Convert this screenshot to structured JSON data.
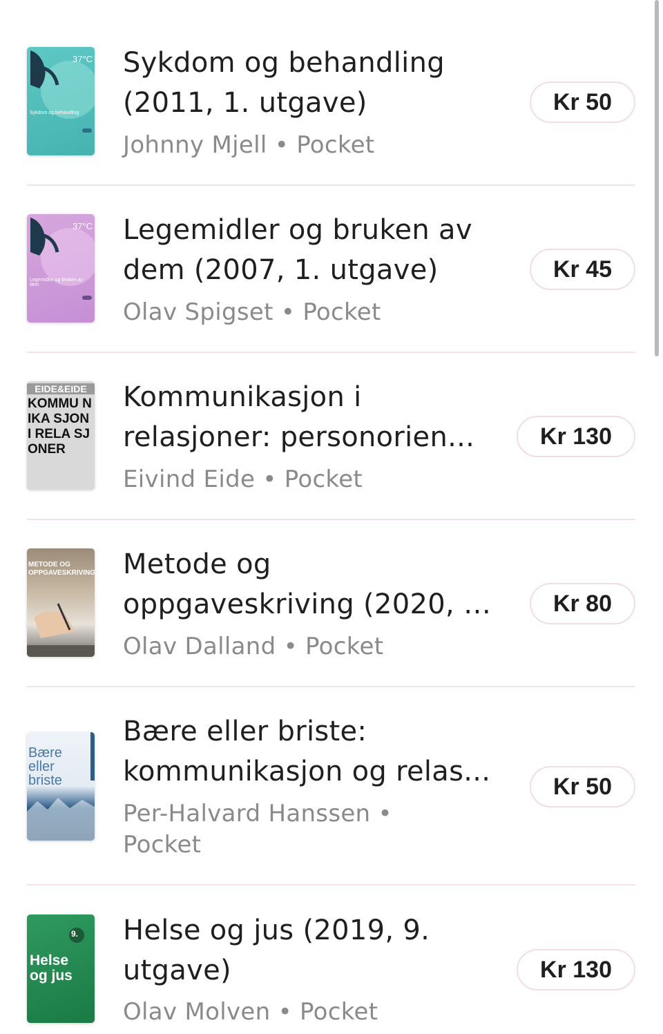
{
  "books": [
    {
      "title_line1": "Sykdom og behandling",
      "title_line2": "(2011, 1. utgave)",
      "author": "Johnny Mjell",
      "format": "Pocket",
      "price": "Kr 50",
      "cover_text": "Sykdom og behandling",
      "cover_badge": "37°C"
    },
    {
      "title_line1": "Legemidler og bruken av",
      "title_line2": "dem (2007, 1. utgave)",
      "author": "Olav Spigset",
      "format": "Pocket",
      "price": "Kr 45",
      "cover_text": "Legemidler og bruken av dem",
      "cover_badge": "37°C"
    },
    {
      "title_line1": "Kommunikasjon i",
      "title_line2": "relasjoner: personorien...",
      "author": "Eivind Eide",
      "format": "Pocket",
      "price": "Kr 130",
      "cover_text": "EIDE&EIDE",
      "cover_big": "KOMMU NIKA SJON I RELA SJONER"
    },
    {
      "title_line1": "Metode og",
      "title_line2": "oppgaveskriving (2020, 7...",
      "author": "Olav Dalland",
      "format": "Pocket",
      "price": "Kr 80",
      "cover_text": "METODE OG OPPGAVESKRIVING"
    },
    {
      "title_line1": "Bære eller briste:",
      "title_line2": "kommunikasjon og relas...",
      "author": "Per-Halvard Hanssen",
      "format": "Pocket",
      "price": "Kr 50",
      "cover_text": "Bære eller briste"
    },
    {
      "title_line1": "Helse og jus (2019, 9.",
      "title_line2": "utgave)",
      "author": "Olav Molven",
      "format": "Pocket",
      "price": "Kr 130",
      "cover_text": "Helse og jus",
      "cover_badge": "9."
    }
  ],
  "separator": "•",
  "colors": {
    "divider": "#f5e2e7",
    "price_border": "#f2dde3",
    "meta_text": "#8a8a8a"
  }
}
